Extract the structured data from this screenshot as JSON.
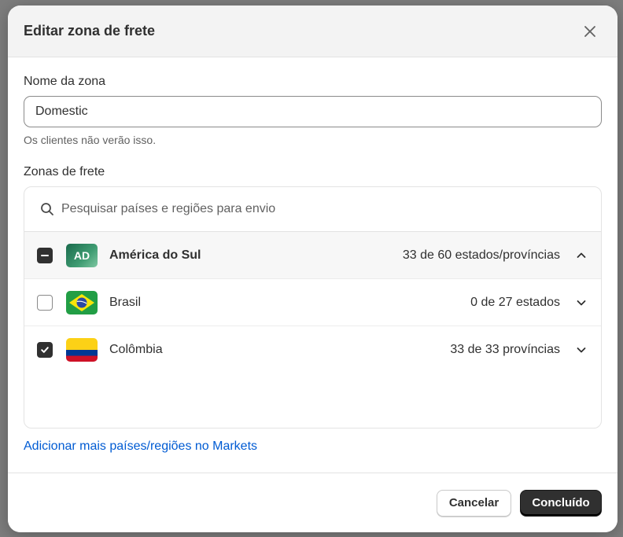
{
  "modal": {
    "title": "Editar zona de frete",
    "close_icon": "close-icon"
  },
  "zone_name_field": {
    "label": "Nome da zona",
    "value": "Domestic",
    "help_text": "Os clientes não verão isso."
  },
  "shipping_zones": {
    "label": "Zonas de frete",
    "search_placeholder": "Pesquisar países e regiões para envio",
    "region": {
      "badge": "AD",
      "name": "América do Sul",
      "count": "33 de 60 estados/províncias",
      "checkbox_state": "indeterminate",
      "expanded": true
    },
    "countries": [
      {
        "name": "Brasil",
        "count": "0 de 27 estados",
        "checked": false,
        "flag": "brazil-flag-icon"
      },
      {
        "name": "Colômbia",
        "count": "33 de 33 províncias",
        "checked": true,
        "flag": "colombia-flag-icon"
      }
    ]
  },
  "markets_link": "Adicionar mais países/regiões no Markets",
  "footer": {
    "cancel_label": "Cancelar",
    "done_label": "Concluído"
  },
  "colors": {
    "primary_button": "#303030",
    "link": "#005bd3",
    "header_bg": "#f3f3f3"
  }
}
